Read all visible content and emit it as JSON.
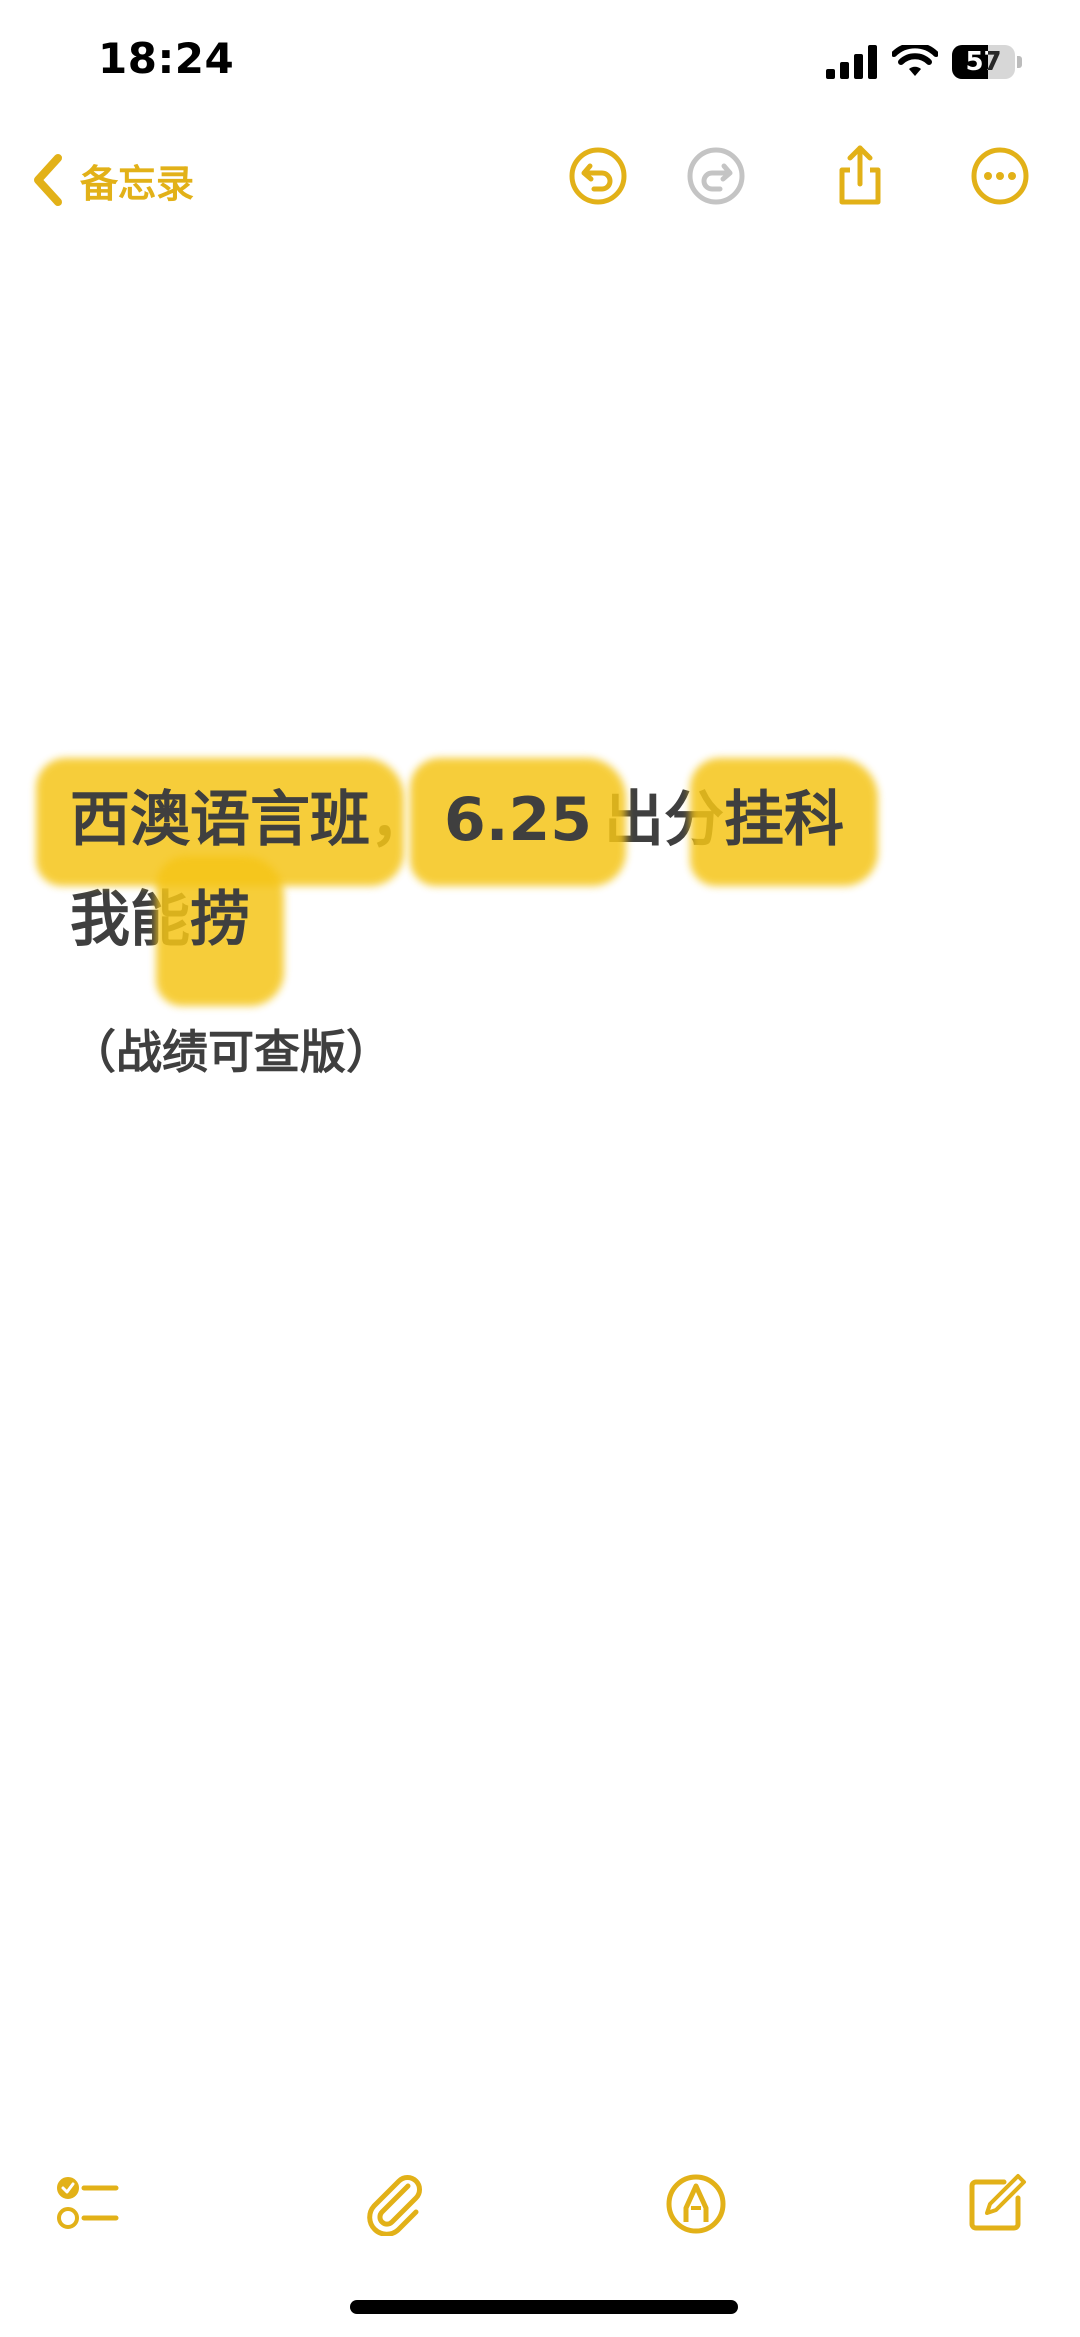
{
  "status_bar": {
    "time": "18:24",
    "battery_level": "57",
    "battery_fraction": 0.57
  },
  "nav": {
    "back_label": "备忘录",
    "icons": [
      "undo-icon",
      "redo-icon",
      "share-icon",
      "more-icon"
    ]
  },
  "note": {
    "title_parts": [
      "西澳语言班",
      "，",
      "6.25",
      "出分",
      "挂科"
    ],
    "title_line2": [
      "我能",
      "捞"
    ],
    "subtitle": "（战绩可查版）"
  },
  "toolbar": {
    "icons": [
      "checklist-icon",
      "attachment-icon",
      "markup-icon",
      "compose-icon"
    ]
  },
  "colors": {
    "accent": "#e2b118",
    "highlight": "#f5c518",
    "text": "#3f3f3f",
    "disabled": "#c4c4c4"
  }
}
